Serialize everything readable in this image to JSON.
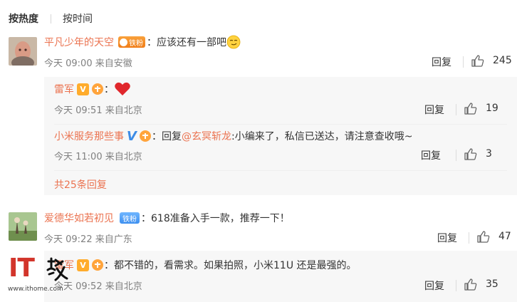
{
  "sort": {
    "active": "按热度",
    "other": "按时间"
  },
  "comments": [
    {
      "user": "平凡少年的天空",
      "badge": "铁粉",
      "text": "：应该还有一部吧",
      "emoji": "smirk-emoji",
      "time": "今天 09:00 来自安徽",
      "reply_label": "回复",
      "likes": "245"
    },
    {
      "user": "爱德华如若初见",
      "badge": "铁粉",
      "text": "：618准备入手一款，推荐一下！",
      "time": "今天 09:22 来自广东",
      "reply_label": "回复",
      "likes": "47"
    }
  ],
  "replies": [
    {
      "user": "雷军",
      "verified": "V",
      "text": "：",
      "emoji": "heart-emoji",
      "time": "今天 09:51 来自北京",
      "reply_label": "回复",
      "likes": "19"
    },
    {
      "user": "小米服务那些事",
      "verified": "V",
      "text_prefix": "：回复",
      "mention": "@玄冥斩龙",
      "text": ":小编来了，私信已送达，请注意查收哦~",
      "time": "今天 11:00 来自北京",
      "reply_label": "回复",
      "likes": "3"
    },
    {
      "user": "雷军",
      "verified": "V",
      "text": "：都不错的，看需求。如果拍照，小米11U 还是最强的。",
      "time": "今天 09:52 来自北京",
      "reply_label": "回复",
      "likes": "35"
    }
  ],
  "more_replies": "共25条回复",
  "watermark": {
    "brand": "IT",
    "url": "www.ithome.com"
  },
  "colors": {
    "accent": "#eb7350",
    "gold_v": "#ffac2c",
    "blue_v": "#3d8ce6",
    "panel": "#f7f7f7"
  }
}
